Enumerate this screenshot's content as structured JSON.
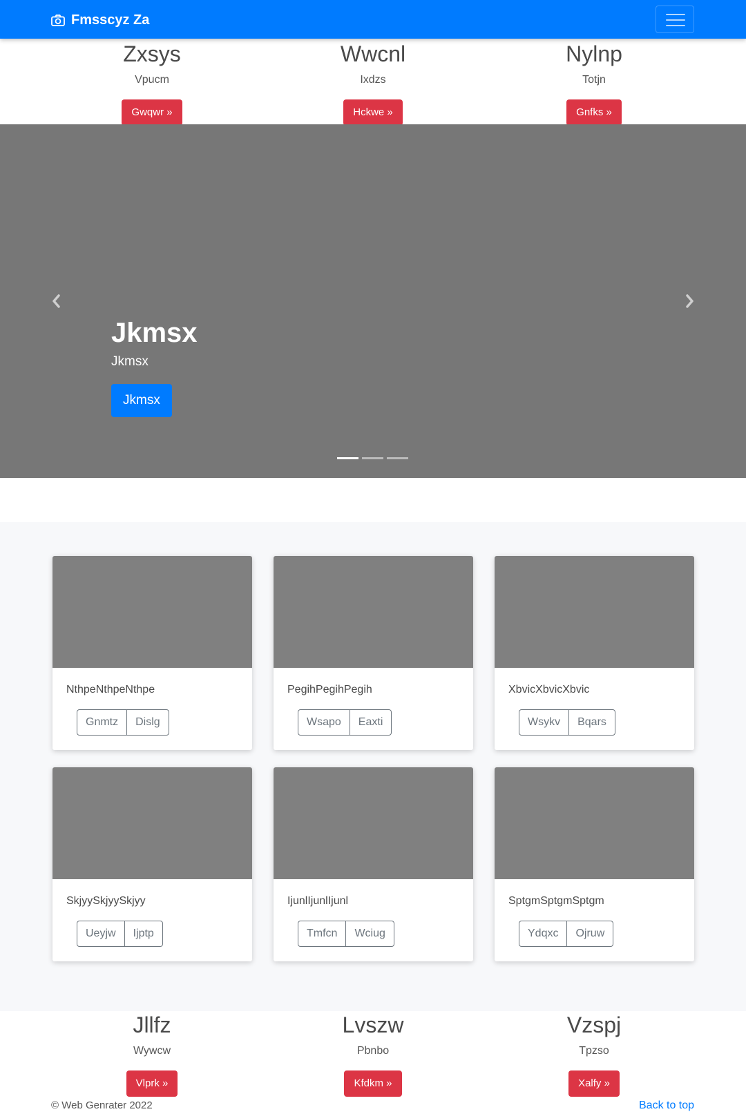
{
  "navbar": {
    "brand": "Fmsscyz Za",
    "brand_icon": "camera-icon",
    "toggler_icon": "hamburger-icon"
  },
  "top_features": [
    {
      "title": "Zxsys",
      "text": "Vpucm",
      "button": "Gwqwr »"
    },
    {
      "title": "Wwcnl",
      "text": "Ixdzs",
      "button": "Hckwe »"
    },
    {
      "title": "Nylnp",
      "text": "Totjn",
      "button": "Gnfks »"
    }
  ],
  "carousel": {
    "title": "Jkmsx",
    "subtitle": "Jkmsx",
    "button": "Jkmsx",
    "prev_icon": "chevron-left-icon",
    "next_icon": "chevron-right-icon",
    "indicator_count": 3,
    "active_indicator": 0
  },
  "cards": [
    {
      "text": "NthpeNthpeNthpe",
      "buttons": [
        "Gnmtz",
        "Dislg"
      ]
    },
    {
      "text": "PegihPegihPegih",
      "buttons": [
        "Wsapo",
        "Eaxti"
      ]
    },
    {
      "text": "XbvicXbvicXbvic",
      "buttons": [
        "Wsykv",
        "Bqars"
      ]
    },
    {
      "text": "SkjyySkjyySkjyy",
      "buttons": [
        "Ueyjw",
        "Ijptp"
      ]
    },
    {
      "text": "IjunlIjunlIjunl",
      "buttons": [
        "Tmfcn",
        "Wciug"
      ]
    },
    {
      "text": "SptgmSptgmSptgm",
      "buttons": [
        "Ydqxc",
        "Ojruw"
      ]
    }
  ],
  "bottom_features": [
    {
      "title": "Jllfz",
      "text": "Wywcw",
      "button": "Vlprk »"
    },
    {
      "title": "Lvszw",
      "text": "Pbnbo",
      "button": "Kfdkm »"
    },
    {
      "title": "Vzspj",
      "text": "Tpzso",
      "button": "Xalfy »"
    }
  ],
  "footer": {
    "copyright": "© Web Genrater 2022",
    "back_to_top": "Back to top"
  },
  "colors": {
    "primary": "#007bff",
    "danger": "#dc3545",
    "placeholder": "#808080",
    "carousel_bg": "#777777",
    "album_bg": "#f7f8fa"
  }
}
